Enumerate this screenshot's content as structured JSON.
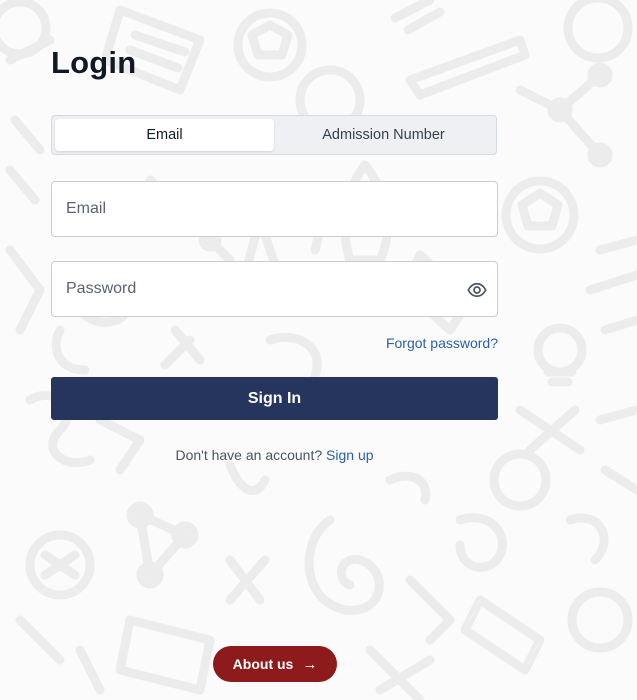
{
  "login": {
    "title": "Login",
    "tabs": [
      {
        "label": "Email",
        "active": true
      },
      {
        "label": "Admission Number",
        "active": false
      }
    ],
    "email_placeholder": "Email",
    "password_placeholder": "Password",
    "password_toggle_icon": "eye-icon",
    "forgot_password": "Forgot password?",
    "sign_in": "Sign In",
    "no_account_text": "Don't have an account?",
    "sign_up": "Sign up"
  },
  "footer": {
    "about_label": "About us",
    "about_icon": "arrow-right-icon",
    "about_arrow": "→"
  },
  "colors": {
    "primary_button": "#25355d",
    "link": "#2c5fa8",
    "about_button": "#8d1b1b",
    "doodle": "#ececec"
  }
}
